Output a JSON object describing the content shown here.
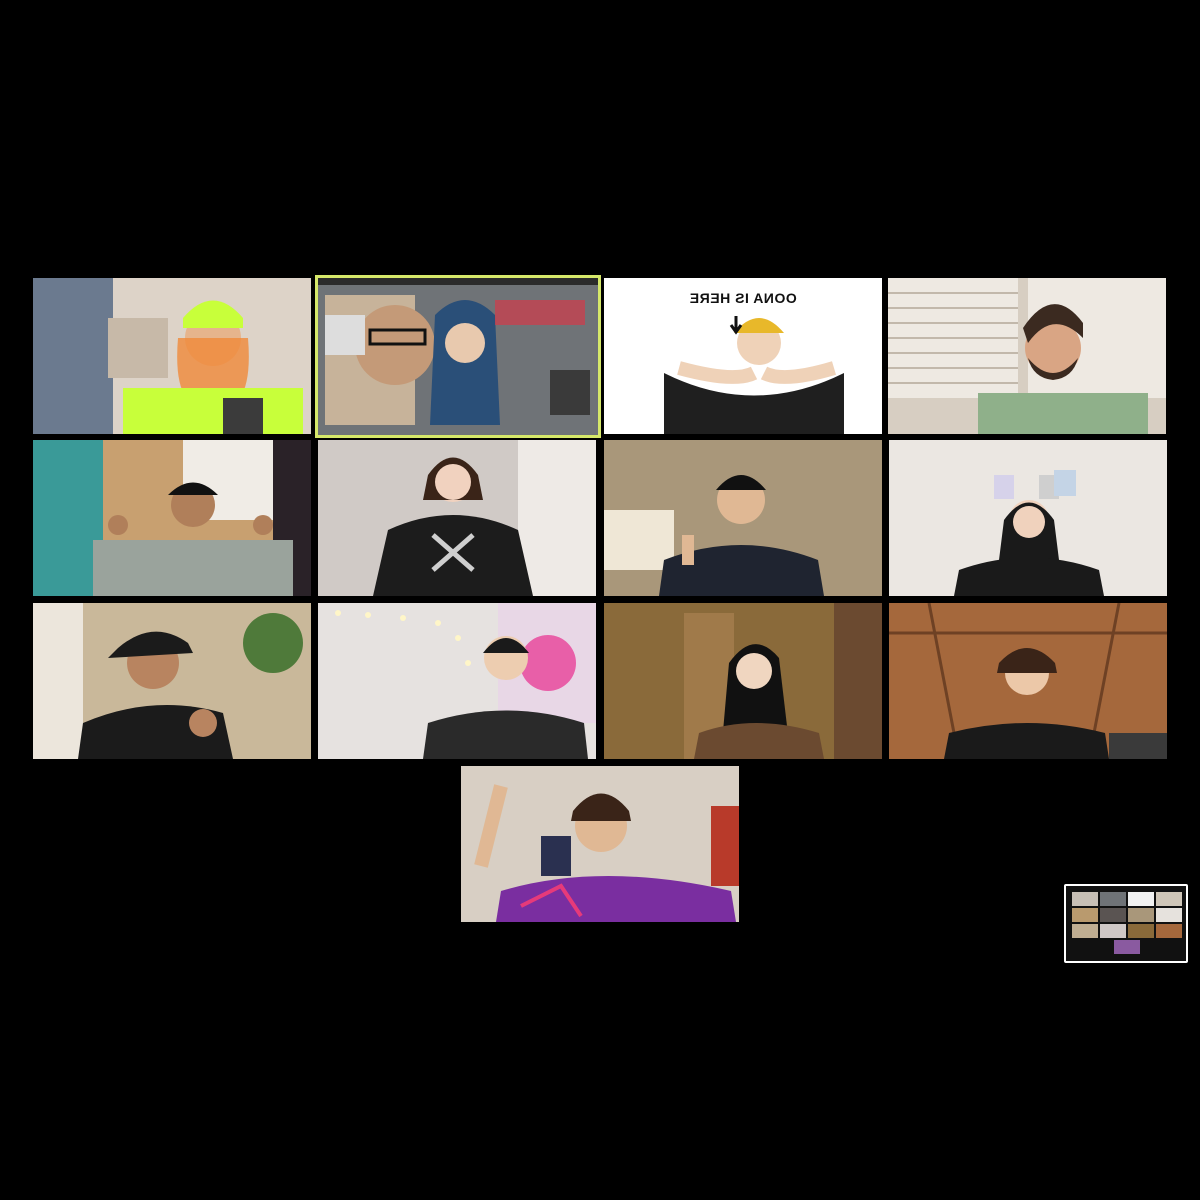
{
  "meeting": {
    "participants_visible": 13,
    "active_speaker_border_color": "#d6e86a",
    "background_color": "#000000"
  },
  "tiles": [
    {
      "id": "p1",
      "bg": "#d9cfc3",
      "accent": "#c8ff3a"
    },
    {
      "id": "p2",
      "bg": "#8a8f95",
      "accent": "#3a5a8a",
      "active": true
    },
    {
      "id": "p3",
      "bg": "#ffffff",
      "accent": "#e8b82a",
      "caption": "OONA IS HERE"
    },
    {
      "id": "p4",
      "bg": "#cfc6b8",
      "accent": "#8fb08a"
    },
    {
      "id": "p5",
      "bg": "#c8a070",
      "accent": "#9aa39c"
    },
    {
      "id": "p6",
      "bg": "#d0cac6",
      "accent": "#1c1c1c"
    },
    {
      "id": "p7",
      "bg": "#a9977a",
      "accent": "#1f2430"
    },
    {
      "id": "p8",
      "bg": "#ebe7e2",
      "accent": "#1a1a1a"
    },
    {
      "id": "p9",
      "bg": "#c9b89a",
      "accent": "#1b1b1b"
    },
    {
      "id": "p10",
      "bg": "#e6e2e0",
      "accent": "#2a2a2a"
    },
    {
      "id": "p11",
      "bg": "#8a6a3a",
      "accent": "#6b4a30"
    },
    {
      "id": "p12",
      "bg": "#a5683c",
      "accent": "#1a1a1a"
    },
    {
      "id": "p13",
      "bg": "#d8cfc4",
      "accent": "#7a2ea0"
    }
  ]
}
